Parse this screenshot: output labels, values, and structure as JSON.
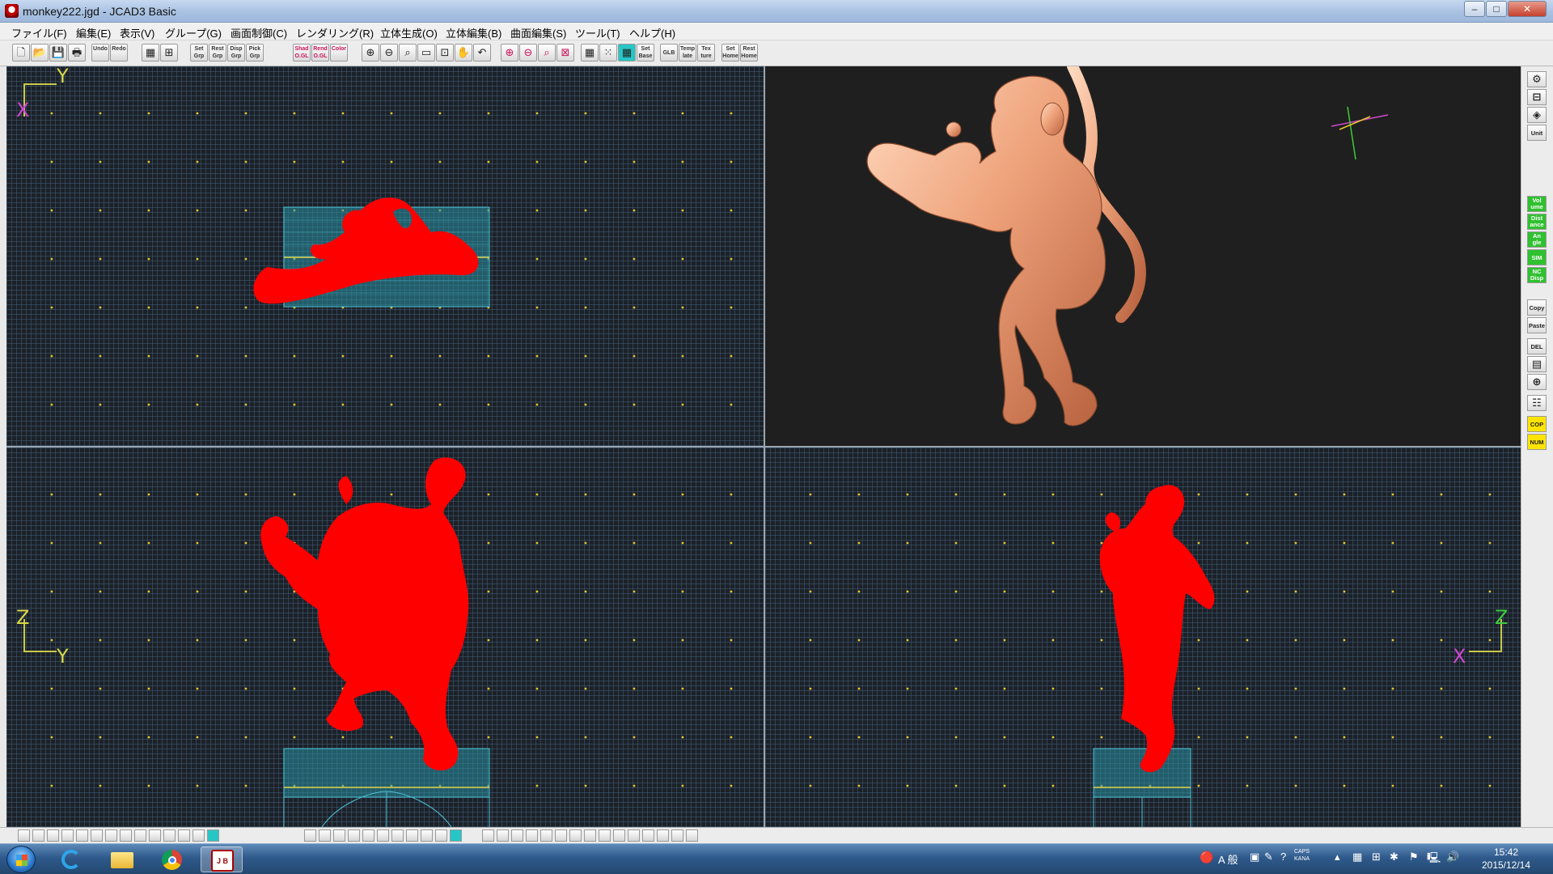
{
  "window": {
    "title": "monkey222.jgd - JCAD3 Basic",
    "buttons": {
      "minimize": "–",
      "maximize": "□",
      "close": "✕"
    }
  },
  "menu": [
    "ファイル(F)",
    "編集(E)",
    "表示(V)",
    "グループ(G)",
    "画面制御(C)",
    "レンダリング(R)",
    "立体生成(O)",
    "立体編集(B)",
    "曲面編集(S)",
    "ツール(T)",
    "ヘルプ(H)"
  ],
  "toolbar": [
    {
      "icon": "new-file-icon",
      "label": ""
    },
    {
      "icon": "open-folder-icon",
      "label": ""
    },
    {
      "icon": "save-disk-icon",
      "label": ""
    },
    {
      "icon": "print-icon",
      "label": ""
    },
    {
      "icon": "undo-icon",
      "label": "Undo"
    },
    {
      "icon": "redo-icon",
      "label": "Redo"
    },
    {
      "icon": "group-tree-icon",
      "label": ""
    },
    {
      "icon": "grid-view-icon",
      "label": ""
    },
    {
      "icon": "set-group-icon",
      "label": "Set\nGrp"
    },
    {
      "icon": "reset-group-icon",
      "label": "Rest\nGrp"
    },
    {
      "icon": "display-group-icon",
      "label": "Disp\nGrp"
    },
    {
      "icon": "pick-group-icon",
      "label": "Pick\nGrp"
    },
    {
      "icon": "shade-ogl-icon",
      "label": "Shad\nO.GL"
    },
    {
      "icon": "render-ogl-icon",
      "label": "Rend\nO.GL"
    },
    {
      "icon": "color-icon",
      "label": "Color"
    },
    {
      "icon": "zoom-in-icon",
      "label": ""
    },
    {
      "icon": "zoom-out-icon",
      "label": ""
    },
    {
      "icon": "zoom-window-icon",
      "label": ""
    },
    {
      "icon": "zoom-fit-icon",
      "label": ""
    },
    {
      "icon": "zoom-all-icon",
      "label": ""
    },
    {
      "icon": "pan-hand-icon",
      "label": ""
    },
    {
      "icon": "back-view-icon",
      "label": ""
    },
    {
      "icon": "zoom-point-icon",
      "label": ""
    },
    {
      "icon": "zoom-center-icon",
      "label": ""
    },
    {
      "icon": "zoom-extent-icon",
      "label": ""
    },
    {
      "icon": "zoom-box-icon",
      "label": ""
    },
    {
      "icon": "grid-icon",
      "label": ""
    },
    {
      "icon": "dot-grid-icon",
      "label": ""
    },
    {
      "icon": "snap-icon",
      "label": ""
    },
    {
      "icon": "set-base-icon",
      "label": "Set\nBase"
    },
    {
      "icon": "global-icon",
      "label": "GLB"
    },
    {
      "icon": "template-icon",
      "label": "Temp\nlate"
    },
    {
      "icon": "texture-icon",
      "label": "Tex\nture"
    },
    {
      "icon": "set-home-icon",
      "label": "Set\nHome"
    },
    {
      "icon": "reset-home-icon",
      "label": "Rest\nHome"
    }
  ],
  "viewports": {
    "top": {
      "axis_v": "Y",
      "axis_h": "X"
    },
    "render": {},
    "front": {
      "axis_v": "Z",
      "axis_h": "Y"
    },
    "side": {
      "axis_v": "Z",
      "axis_h": "X"
    }
  },
  "rightbar": [
    {
      "icon": "view-gear-icon",
      "label": ""
    },
    {
      "icon": "measure-icon",
      "label": ""
    },
    {
      "icon": "layers-icon",
      "label": ""
    },
    {
      "icon": "unit-icon",
      "label": "Unit"
    },
    {
      "icon": "volume-icon",
      "label": "Vol\nume",
      "style": "green"
    },
    {
      "icon": "distance-icon",
      "label": "Dist\nance",
      "style": "green"
    },
    {
      "icon": "angle-icon",
      "label": "An\ngle",
      "style": "green"
    },
    {
      "icon": "sim-icon",
      "label": "SIM",
      "style": "green"
    },
    {
      "icon": "nc-disp-icon",
      "label": "NC\nDisp",
      "style": "green"
    },
    {
      "icon": "copy-icon",
      "label": "Copy"
    },
    {
      "icon": "paste-icon",
      "label": "Paste"
    },
    {
      "icon": "delete-icon",
      "label": "DEL"
    },
    {
      "icon": "property-icon",
      "label": ""
    },
    {
      "icon": "transform-icon",
      "label": ""
    },
    {
      "icon": "tree-icon",
      "label": ""
    },
    {
      "icon": "cop-icon",
      "label": "COP",
      "style": "yellow"
    },
    {
      "icon": "num-icon",
      "label": "NUM",
      "style": "yellow"
    }
  ],
  "taskbar": {
    "ime": "A 般",
    "clock_time": "15:42",
    "clock_date": "2015/12/14",
    "tray_caps": "CAPS\nKANA"
  },
  "colors": {
    "model": "#ff0000",
    "render": "#e8966b",
    "grid_dot": "#e5c62a",
    "base_block": "#2a8fa0"
  }
}
